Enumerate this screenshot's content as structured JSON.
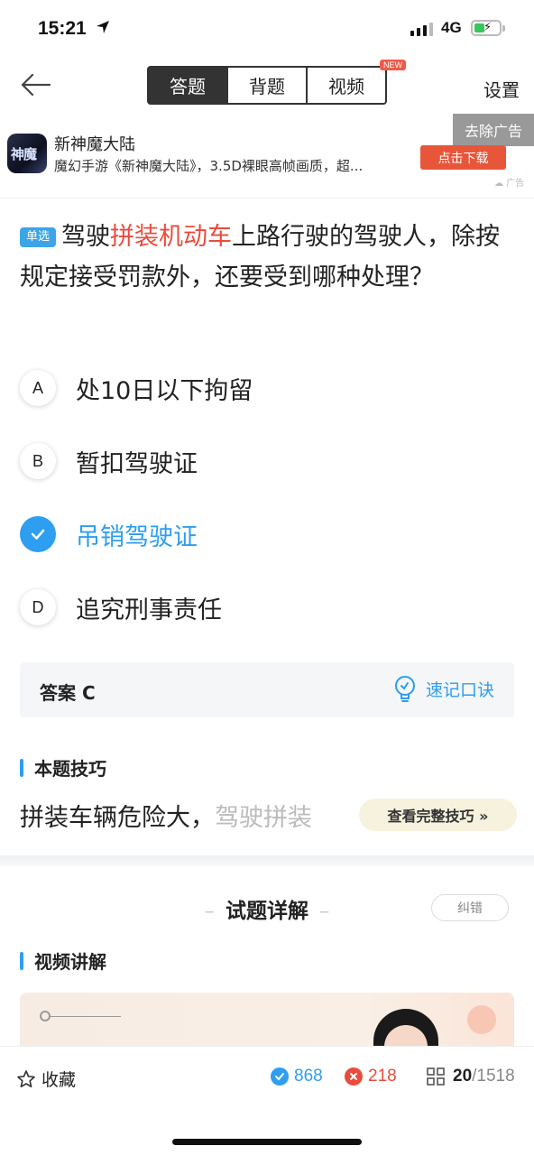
{
  "status_bar": {
    "time": "15:21",
    "network": "4G",
    "battery_color": "#34c759"
  },
  "nav": {
    "back_icon": "arrow-left-icon",
    "tabs": [
      {
        "label": "答题",
        "active": true
      },
      {
        "label": "背题",
        "active": false
      },
      {
        "label": "视频",
        "active": false
      }
    ],
    "new_badge": "NEW",
    "settings_label": "设置"
  },
  "ad": {
    "logo_text": "神魔",
    "title": "新神魔大陆",
    "description": "魔幻手游《新神魔大陆》，3.5D裸眼高帧画质，超...",
    "remove_label": "去除广告",
    "download_label": "点击下载",
    "ad_tag": "广告"
  },
  "question": {
    "type_tag": "单选",
    "text_before": "驾驶",
    "text_highlight": "拼装机动车",
    "text_after": "上路行驶的驾驶人，除按规定接受罚款外，还要受到哪种处理？",
    "highlight_color": "#e84c3d"
  },
  "options": [
    {
      "letter": "A",
      "text": "处10日以下拘留",
      "selected": false
    },
    {
      "letter": "B",
      "text": "暂扣驾驶证",
      "selected": false
    },
    {
      "letter": "C",
      "text": "吊销驾驶证",
      "selected": true
    },
    {
      "letter": "D",
      "text": "追究刑事责任",
      "selected": false
    }
  ],
  "answer": {
    "label": "答案 C",
    "mnemonic_label": "速记口诀",
    "mnemonic_icon": "lightbulb-icon"
  },
  "tips": {
    "title": "本题技巧",
    "text": "拼装车辆危险大，",
    "text_faded": "驾驶拼装",
    "button_label": "查看完整技巧 »"
  },
  "details": {
    "heading": "试题详解",
    "correction_label": "纠错",
    "video_title": "视频讲解"
  },
  "bottom": {
    "favorite_label": "收藏",
    "correct_count": "868",
    "wrong_count": "218",
    "current": "20",
    "total": "/1518",
    "accent_blue": "#2e9ef0",
    "accent_red": "#e84c3d"
  }
}
